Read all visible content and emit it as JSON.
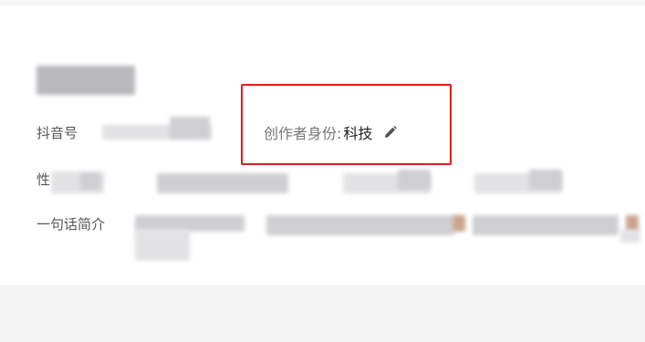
{
  "profile": {
    "douyin_id_label": "抖音号",
    "gender_label_partial": "性",
    "bio_label": "一句话简介"
  },
  "creator": {
    "identity_label": "创作者身份:",
    "identity_value": "科技",
    "edit_icon": "pencil-icon"
  },
  "colors": {
    "highlight": "#e21d1d",
    "text_muted": "#777777"
  }
}
